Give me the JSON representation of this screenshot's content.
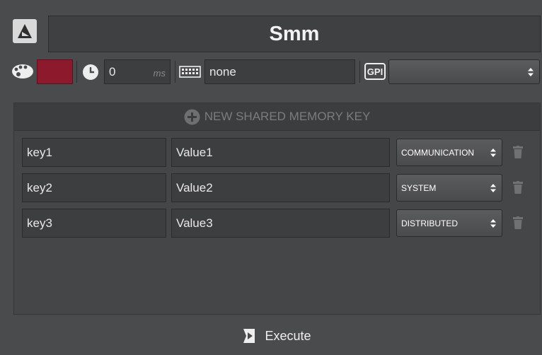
{
  "header": {
    "title": "Smm",
    "logo_icon": "viz-logo-icon"
  },
  "toolbar": {
    "color_swatch": "#8c1a2c",
    "delay_value": "0",
    "delay_unit": "ms",
    "keyboard_value": "none",
    "gpi_label": "GPI",
    "gpi_selected": ""
  },
  "panel": {
    "new_key_label": "NEW SHARED MEMORY KEY",
    "rows": [
      {
        "key": "key1",
        "value": "Value1",
        "map": "COMMUNICATION"
      },
      {
        "key": "key2",
        "value": "Value2",
        "map": "SYSTEM"
      },
      {
        "key": "key3",
        "value": "Value3",
        "map": "DISTRIBUTED"
      }
    ]
  },
  "footer": {
    "execute_label": "Execute"
  },
  "colors": {
    "background": "#4a4b4c",
    "panel": "#454647",
    "accent": "#8c1a2c"
  }
}
